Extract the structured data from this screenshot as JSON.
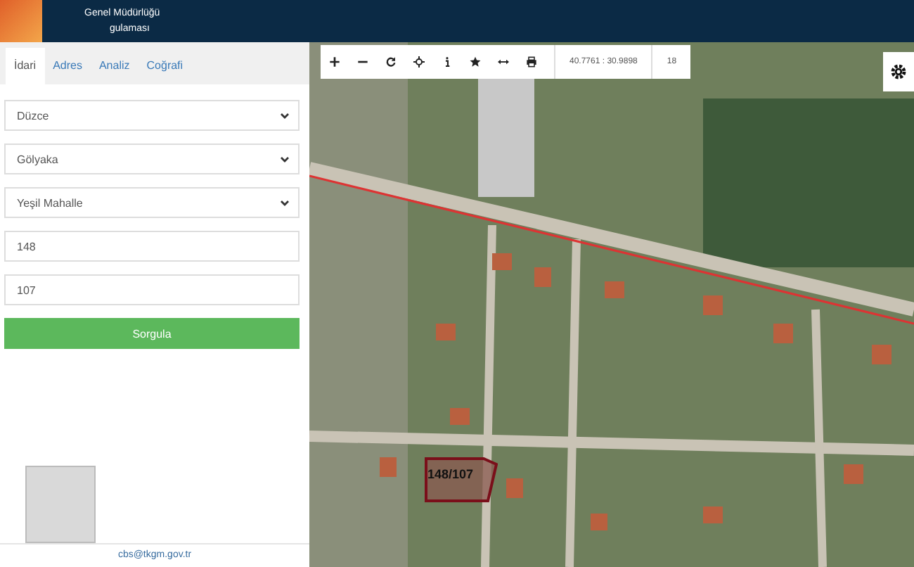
{
  "header": {
    "title": "Genel Müdürlüğü",
    "subtitle": "gulaması"
  },
  "tabs": [
    {
      "label": "İdari",
      "selected": true
    },
    {
      "label": "Adres",
      "selected": false
    },
    {
      "label": "Analiz",
      "selected": false
    },
    {
      "label": "Coğrafi",
      "selected": false
    }
  ],
  "form": {
    "fields": [
      {
        "kind": "select",
        "value": "Düzce"
      },
      {
        "kind": "select",
        "value": "Gölyaka"
      },
      {
        "kind": "select",
        "value": "Yeşil Mahalle"
      },
      {
        "kind": "input",
        "value": "148"
      },
      {
        "kind": "input",
        "value": "107"
      }
    ],
    "button": "Sorgula"
  },
  "footer": {
    "email": "cbs@tkgm.gov.tr"
  },
  "map": {
    "toolbar": {
      "tools": [
        {
          "kind": "zoom-in"
        },
        {
          "kind": "zoom-out"
        },
        {
          "kind": "refresh"
        },
        {
          "kind": "locate"
        },
        {
          "kind": "info"
        },
        {
          "kind": "favorite"
        },
        {
          "kind": "measure"
        },
        {
          "kind": "print"
        }
      ],
      "coordinates": "40.7761 : 30.9898",
      "zoom": "18"
    },
    "parcel": {
      "label": "148/107"
    }
  }
}
